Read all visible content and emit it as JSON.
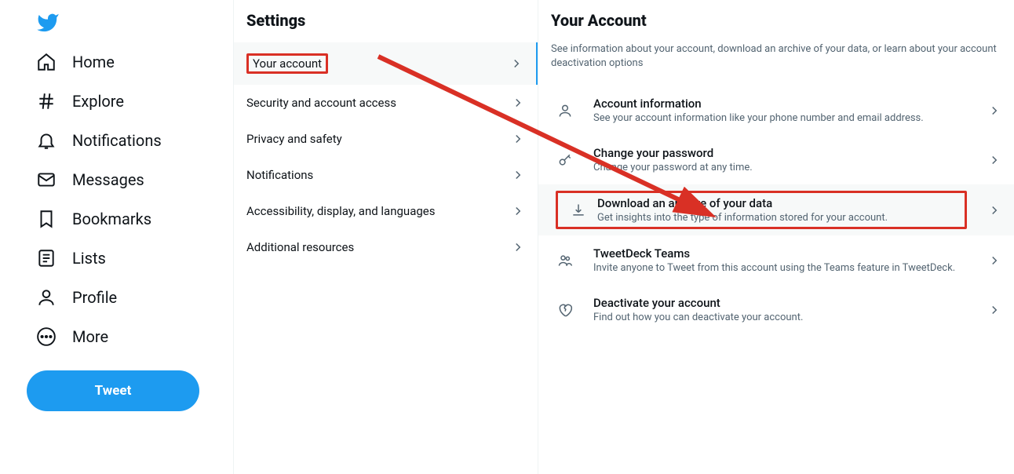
{
  "nav": {
    "items": [
      {
        "label": "Home"
      },
      {
        "label": "Explore"
      },
      {
        "label": "Notifications"
      },
      {
        "label": "Messages"
      },
      {
        "label": "Bookmarks"
      },
      {
        "label": "Lists"
      },
      {
        "label": "Profile"
      },
      {
        "label": "More"
      }
    ],
    "tweet_label": "Tweet"
  },
  "settings": {
    "title": "Settings",
    "items": [
      {
        "label": "Your account"
      },
      {
        "label": "Security and account access"
      },
      {
        "label": "Privacy and safety"
      },
      {
        "label": "Notifications"
      },
      {
        "label": "Accessibility, display, and languages"
      },
      {
        "label": "Additional resources"
      }
    ]
  },
  "account": {
    "title": "Your Account",
    "desc": "See information about your account, download an archive of your data, or learn about your account deactivation options",
    "items": [
      {
        "title": "Account information",
        "sub": "See your account information like your phone number and email address."
      },
      {
        "title": "Change your password",
        "sub": "Change your password at any time."
      },
      {
        "title": "Download an archive of your data",
        "sub": "Get insights into the type of information stored for your account."
      },
      {
        "title": "TweetDeck Teams",
        "sub": "Invite anyone to Tweet from this account using the Teams feature in TweetDeck."
      },
      {
        "title": "Deactivate your account",
        "sub": "Find out how you can deactivate your account."
      }
    ]
  }
}
